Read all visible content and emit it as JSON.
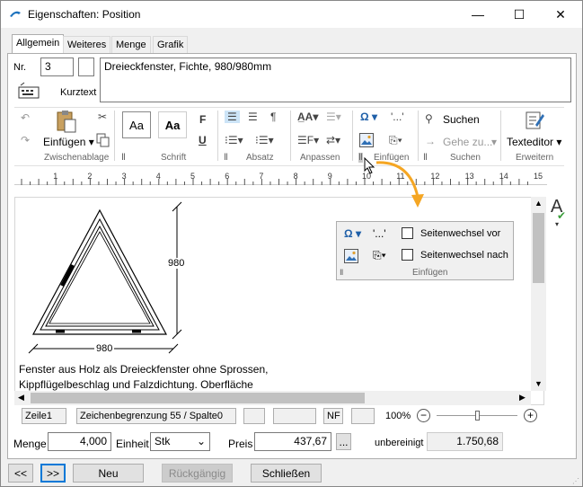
{
  "window": {
    "title": "Eigenschaften: Position",
    "minimize": "—",
    "maximize": "☐",
    "close": "✕"
  },
  "tabs": [
    "Allgemein",
    "Weiteres",
    "Menge",
    "Grafik"
  ],
  "header": {
    "nr_label": "Nr.",
    "nr_value": "3",
    "kurztext_label": "Kurztext",
    "kurztext_value": "Dreieckfenster, Fichte, 980/980mm"
  },
  "ribbon": {
    "einfuegen_label": "Einfügen ▾",
    "zwischenablage": "Zwischenablage",
    "schrift": "Schrift",
    "absatz": "Absatz",
    "anpassen": "Anpassen",
    "einfuegen_group": "Einfügen",
    "suchen_group": "Suchen",
    "erweitern": "Erweitern",
    "suchen_btn": "Suchen",
    "gehe_zu": "Gehe zu...",
    "texteditor": "Texteditor ▾",
    "style_aa": "Aa",
    "font_f": "F",
    "font_u": "U",
    "omega": "Ω ▾",
    "quote": "'...'"
  },
  "ruler_numbers": [
    "1",
    "2",
    "3",
    "4",
    "5",
    "6",
    "7",
    "8",
    "9",
    "10",
    "11",
    "12",
    "13",
    "14",
    "15"
  ],
  "editor": {
    "dim_right": "980",
    "dim_bottom": "980",
    "text_line1": "Fenster aus Holz als Dreieckfenster ohne Sprossen,",
    "text_line2": "Kippflügelbeschlag und Falzdichtung. Oberfläche"
  },
  "popup": {
    "omega": "Ω ▾",
    "quote": "'...'",
    "seitenwechsel_vor": "Seitenwechsel vor",
    "seitenwechsel_nach": "Seitenwechsel nach",
    "group_label": "Einfügen"
  },
  "statusbar": {
    "zeile": "Zeile1",
    "position": "Zeichenbegrenzung 55 / Spalte0",
    "nf": "NF",
    "zoom": "100%"
  },
  "quantity": {
    "menge_label": "Menge",
    "menge_value": "4,000",
    "einheit_label": "Einheit",
    "einheit_value": "Stk",
    "preis_label": "Preis",
    "preis_value": "437,67",
    "dots": "...",
    "unbereinigt_label": "unbereinigt",
    "unbereinigt_value": "1.750,68"
  },
  "footer": {
    "prev": "<<",
    "next": ">>",
    "neu": "Neu",
    "rueckgaengig": "Rückgängig",
    "schliessen": "Schließen"
  },
  "colors": {
    "accent": "#0078d7",
    "arrow": "#f5a623",
    "check_green": "#3a9d3a"
  }
}
